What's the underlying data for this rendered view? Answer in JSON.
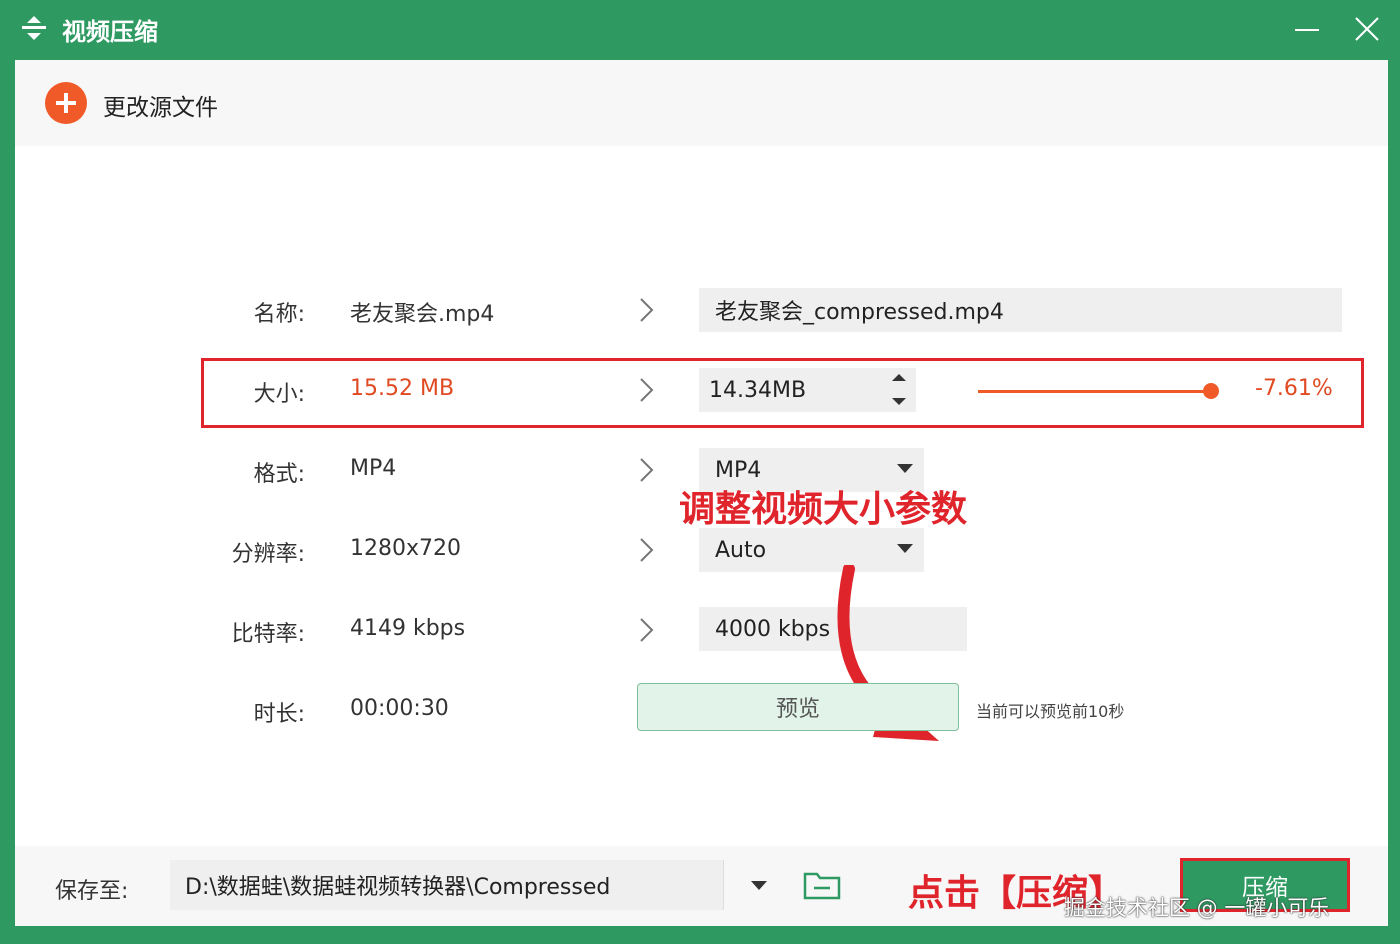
{
  "window": {
    "title": "视频压缩",
    "icons": {
      "app": "compress-icon",
      "minimize": "minimize-icon",
      "close": "close-icon"
    }
  },
  "toolbar": {
    "change_source_label": "更改源文件",
    "icon": "plus-icon"
  },
  "rows": {
    "name": {
      "label": "名称:",
      "source": "老友聚会.mp4",
      "target": "老友聚会_compressed.mp4"
    },
    "size": {
      "label": "大小:",
      "source": "15.52 MB",
      "target": "14.34MB",
      "percent": "-7.61%",
      "slider_fraction": 0.97
    },
    "format": {
      "label": "格式:",
      "source": "MP4",
      "target": "MP4"
    },
    "resolution": {
      "label": "分辨率:",
      "source": "1280x720",
      "target": "Auto"
    },
    "bitrate": {
      "label": "比特率:",
      "source": "4149 kbps",
      "target": "4000 kbps"
    },
    "duration": {
      "label": "时长:",
      "source": "00:00:30",
      "preview_label": "预览",
      "preview_note": "当前可以预览前10秒"
    }
  },
  "annotations": {
    "adjust": "调整视频大小参数",
    "click": "点击【压缩】"
  },
  "bottom": {
    "save_label": "保存至:",
    "path": "D:\\数据蛙\\数据蛙视频转换器\\Compressed",
    "compress_label": "压缩",
    "folder_icon": "folder-icon"
  },
  "watermark": "掘金技术社区 @ 一罐小可乐",
  "colors": {
    "brand_green": "#2e9a62",
    "accent_orange": "#f05a28",
    "annotation_red": "#e0242c"
  }
}
